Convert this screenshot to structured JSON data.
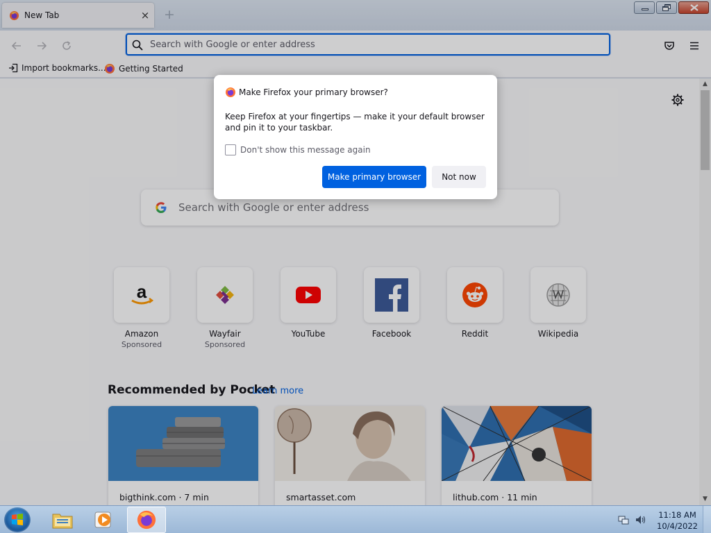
{
  "window": {
    "tab_title": "New Tab",
    "tab_close": "×",
    "new_tab": "+"
  },
  "navbar": {
    "urlbar_placeholder": "Search with Google or enter address"
  },
  "bookmarks": {
    "items": [
      {
        "label": "Import bookmarks..."
      },
      {
        "label": "Getting Started"
      }
    ]
  },
  "newtab": {
    "search_placeholder": "Search with Google or enter address",
    "top_sites": [
      {
        "label": "Amazon",
        "sponsored": "Sponsored"
      },
      {
        "label": "Wayfair",
        "sponsored": "Sponsored"
      },
      {
        "label": "YouTube",
        "sponsored": ""
      },
      {
        "label": "Facebook",
        "sponsored": ""
      },
      {
        "label": "Reddit",
        "sponsored": ""
      },
      {
        "label": "Wikipedia",
        "sponsored": ""
      }
    ],
    "pocket": {
      "title": "Recommended by Pocket",
      "learn_more": "Learn more",
      "cards": [
        {
          "source": "bigthink.com · 7 min"
        },
        {
          "source": "smartasset.com"
        },
        {
          "source": "lithub.com · 11 min"
        }
      ]
    }
  },
  "dialog": {
    "heading": "Make Firefox your primary browser?",
    "body": "Keep Firefox at your fingertips — make it your default browser and pin it to your taskbar.",
    "checkbox_label": "Don't show this message again",
    "checkbox_checked": false,
    "primary_button": "Make primary browser",
    "secondary_button": "Not now"
  },
  "taskbar": {
    "time": "11:18 AM",
    "date": "10/4/2022"
  },
  "colors": {
    "accent": "#0061e0",
    "page_bg": "#f9f9fb"
  }
}
